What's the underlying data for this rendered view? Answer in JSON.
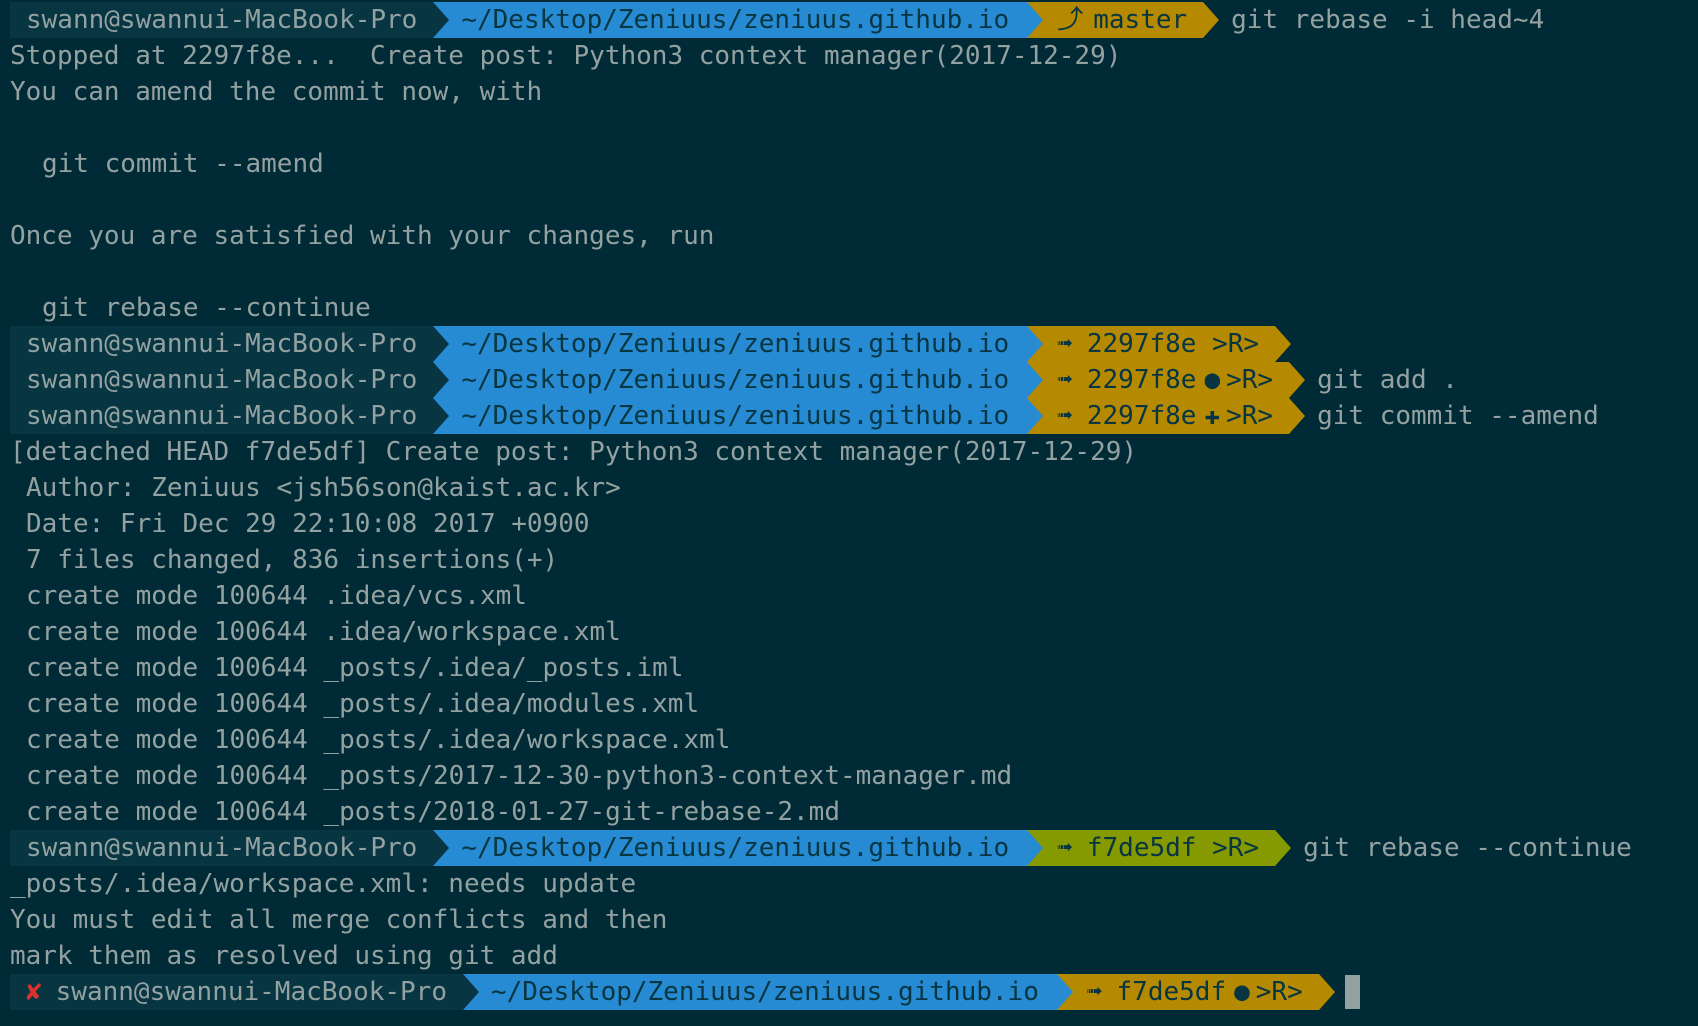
{
  "prompt": {
    "user_host": "swann@swannui-MacBook-Pro",
    "cwd": "~/Desktop/Zeniuus/zeniuus.github.io"
  },
  "colors": {
    "background": "#002b36",
    "user_segment": "#073642",
    "dir_segment": "#268bd2",
    "git_clean_segment": "#b58900",
    "git_green_segment": "#859900",
    "error": "#dc322f",
    "text": "#93a1a1"
  },
  "icons": {
    "branch": "branch-icon",
    "detached": "detached-head-icon",
    "dirty": "dirty-dot-icon",
    "staged": "staged-plus-icon",
    "error": "error-x-icon"
  },
  "lines": {
    "l1": {
      "git": "master",
      "branch_glyph": "⤴",
      "cmd": "git rebase -i head~4"
    },
    "l2": "Stopped at 2297f8e...  Create post: Python3 context manager(2017-12-29)",
    "l3": "You can amend the commit now, with",
    "l5": "git commit --amend",
    "l7": "Once you are satisfied with your changes, run",
    "l9": "git rebase --continue",
    "l10": {
      "git": "2297f8e",
      "suffix": ">R>",
      "arrow_glyph": "➟"
    },
    "l11": {
      "git": "2297f8e",
      "state_glyph": "●",
      "suffix": ">R>",
      "arrow_glyph": "➟",
      "cmd": "git add ."
    },
    "l12": {
      "git": "2297f8e",
      "state_glyph": "✚",
      "suffix": ">R>",
      "arrow_glyph": "➟",
      "cmd": "git commit --amend"
    },
    "l13": "[detached HEAD f7de5df] Create post: Python3 context manager(2017-12-29)",
    "l14": "Author: Zeniuus <jsh56son@kaist.ac.kr>",
    "l15": "Date: Fri Dec 29 22:10:08 2017 +0900",
    "l16": "7 files changed, 836 insertions(+)",
    "l17": "create mode 100644 .idea/vcs.xml",
    "l18": "create mode 100644 .idea/workspace.xml",
    "l19": "create mode 100644 _posts/.idea/_posts.iml",
    "l20": "create mode 100644 _posts/.idea/modules.xml",
    "l21": "create mode 100644 _posts/.idea/workspace.xml",
    "l22": "create mode 100644 _posts/2017-12-30-python3-context-manager.md",
    "l23": "create mode 100644 _posts/2018-01-27-git-rebase-2.md",
    "l24": {
      "git": "f7de5df",
      "suffix": ">R>",
      "arrow_glyph": "➟",
      "cmd": "git rebase --continue"
    },
    "l25": "_posts/.idea/workspace.xml: needs update",
    "l26": "You must edit all merge conflicts and then",
    "l27": "mark them as resolved using git add",
    "l28": {
      "error_glyph": "✘",
      "git": "f7de5df",
      "state_glyph": "●",
      "suffix": ">R>",
      "arrow_glyph": "➟"
    }
  }
}
